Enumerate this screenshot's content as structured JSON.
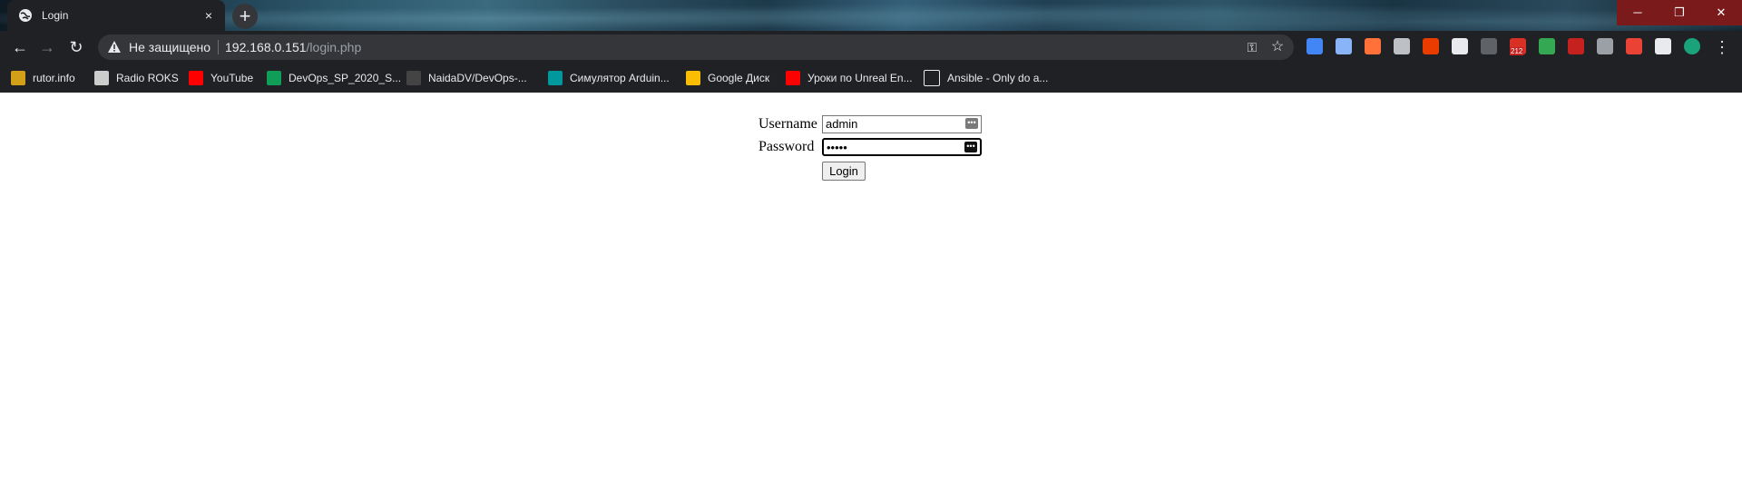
{
  "tab": {
    "title": "Login",
    "close": "×"
  },
  "new_tab": "+",
  "window_controls": {
    "minimize": "─",
    "maximize": "❐",
    "close": "✕"
  },
  "address_bar": {
    "security_label": "Не защищено",
    "url_host": "192.168.0.151",
    "url_path": "/login.php"
  },
  "bookmarks": [
    {
      "label": "rutor.info",
      "icon": "rutor-icon",
      "color": "#d4a017"
    },
    {
      "label": "Radio ROKS",
      "icon": "radio-roks-icon",
      "color": "#cccccc"
    },
    {
      "label": "YouTube",
      "icon": "youtube-icon",
      "color": "#ff0000"
    },
    {
      "label": "DevOps_SP_2020_S...",
      "icon": "sheets-icon",
      "color": "#0f9d58"
    },
    {
      "label": "NaidaDV/DevOps-...",
      "icon": "github-icon",
      "color": "#444444"
    },
    {
      "label": "Симулятор Arduin...",
      "icon": "arduino-icon",
      "color": "#00979d"
    },
    {
      "label": "Google Диск",
      "icon": "google-drive-icon",
      "color": "#fbbc04"
    },
    {
      "label": "Уроки по Unreal En...",
      "icon": "youtube-icon",
      "color": "#ff0000"
    },
    {
      "label": "Ansible - Only do a...",
      "icon": "page-icon",
      "color": "#202124"
    }
  ],
  "extensions": [
    {
      "name": "translate-icon",
      "color": "#4285f4"
    },
    {
      "name": "copy-icon",
      "color": "#8ab4f8"
    },
    {
      "name": "firefox-icon",
      "color": "#ff7139"
    },
    {
      "name": "card-icon",
      "color": "#bdc1c6"
    },
    {
      "name": "office-icon",
      "color": "#eb3c00"
    },
    {
      "name": "speed-icon",
      "color": "#e8eaed"
    },
    {
      "name": "more-dots-icon",
      "color": "#5f6368"
    },
    {
      "name": "mail-icon",
      "color": "#d93025",
      "badge": "212"
    },
    {
      "name": "shield-icon",
      "color": "#34a853"
    },
    {
      "name": "pdf-icon",
      "color": "#c5221f"
    },
    {
      "name": "circle-icon",
      "color": "#9aa0a6"
    },
    {
      "name": "m-icon",
      "color": "#ea4335"
    },
    {
      "name": "puzzle-icon",
      "color": "#e8eaed"
    },
    {
      "name": "avatar-icon",
      "color": "#1aa37a"
    }
  ],
  "form": {
    "username_label": "Username",
    "username_value": "admin",
    "password_label": "Password",
    "password_value": "•••••",
    "login_button": "Login"
  }
}
